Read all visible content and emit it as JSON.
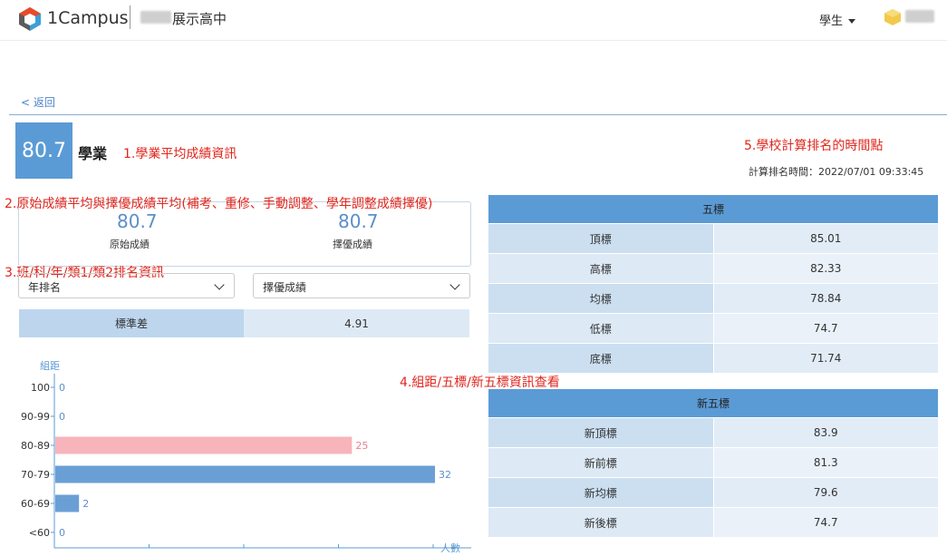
{
  "header": {
    "brand": "1Campus",
    "school": "展示高中",
    "role": "學生"
  },
  "back_label": "< 返回",
  "score": {
    "value": "80.7",
    "label": "學業"
  },
  "annotations": {
    "a1": "1.學業平均成績資訊",
    "a2": "2.原始成績平均與擇優成績平均(補考、重修、手動調整、學年調整成績擇優)",
    "a3": "3.班/科/年/類1/類2排名資訊",
    "a4": "4.組距/五標/新五標資訊查看",
    "a5": "5.學校計算排名的時間點"
  },
  "rank_time": "計算排名時間：2022/07/01 09:33:45",
  "averages": {
    "original": {
      "value": "80.7",
      "label": "原始成績"
    },
    "best": {
      "value": "80.7",
      "label": "擇優成績"
    }
  },
  "selects": {
    "rank_type": "年排名",
    "score_type": "擇優成績"
  },
  "std": {
    "label": "標準差",
    "value": "4.91"
  },
  "five_marks": {
    "title": "五標",
    "rows": [
      {
        "name": "頂標",
        "value": "85.01"
      },
      {
        "name": "高標",
        "value": "82.33"
      },
      {
        "name": "均標",
        "value": "78.84"
      },
      {
        "name": "低標",
        "value": "74.7"
      },
      {
        "name": "底標",
        "value": "71.74"
      }
    ]
  },
  "new_five_marks": {
    "title": "新五標",
    "rows": [
      {
        "name": "新頂標",
        "value": "83.9"
      },
      {
        "name": "新前標",
        "value": "81.3"
      },
      {
        "name": "新均標",
        "value": "79.6"
      },
      {
        "name": "新後標",
        "value": "74.7"
      }
    ]
  },
  "chart_data": {
    "type": "bar",
    "orientation": "horizontal",
    "ylabel": "組距",
    "xlabel": "人數",
    "categories": [
      "100",
      "90-99",
      "80-89",
      "70-79",
      "60-69",
      "<60"
    ],
    "values": [
      0,
      0,
      25,
      32,
      2,
      0
    ],
    "xlim": [
      0,
      32
    ],
    "highlight_category": "80-89",
    "colors": {
      "bar": "#6a9fd6",
      "highlight": "#f7b4ba",
      "axis": "#5b9bd5"
    }
  }
}
